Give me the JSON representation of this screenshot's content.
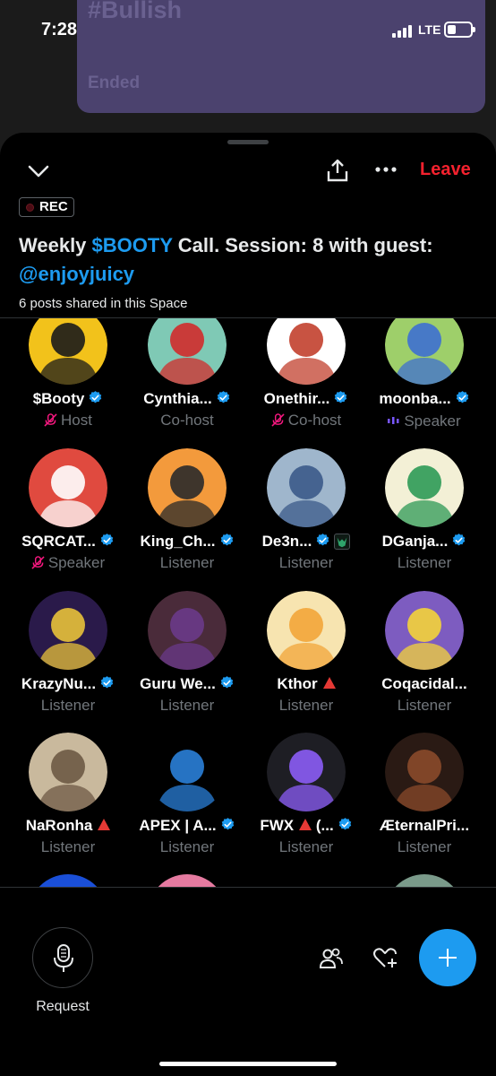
{
  "status": {
    "time": "7:28",
    "network": "LTE"
  },
  "background_card": {
    "title": "#Bullish",
    "status": "Ended"
  },
  "header": {
    "leave_label": "Leave",
    "rec_label": "REC"
  },
  "space": {
    "title_pre": "Weekly ",
    "title_ticker": "$BOOTY",
    "title_mid": " Call. Session: 8 with guest: ",
    "title_guest": "@enjoyjuicy",
    "posts_shared": "6 posts shared in this Space"
  },
  "participants": [
    {
      "name": "$Booty",
      "verified": true,
      "badge": "",
      "role": "Host",
      "mic": "muted",
      "avatar_colors": [
        "#f2c21b",
        "#1b1b1b"
      ]
    },
    {
      "name": "Cynthia...",
      "verified": true,
      "badge": "",
      "role": "Co-host",
      "mic": "none",
      "avatar_colors": [
        "#7fc9b5",
        "#d22b2b"
      ]
    },
    {
      "name": "Onethir...",
      "verified": true,
      "badge": "",
      "role": "Co-host",
      "mic": "muted",
      "avatar_colors": [
        "#ffffff",
        "#c2402e"
      ]
    },
    {
      "name": "moonba...",
      "verified": true,
      "badge": "",
      "role": "Speaker",
      "mic": "speaking",
      "avatar_colors": [
        "#9ecf6a",
        "#3d6fd1"
      ]
    },
    {
      "name": "SQRCAT...",
      "verified": true,
      "badge": "",
      "role": "Speaker",
      "mic": "muted",
      "avatar_colors": [
        "#e04a3f",
        "#ffffff"
      ]
    },
    {
      "name": "King_Ch...",
      "verified": true,
      "badge": "",
      "role": "Listener",
      "mic": "none",
      "avatar_colors": [
        "#f39a3c",
        "#2a2a2a"
      ]
    },
    {
      "name": "De3n...",
      "verified": true,
      "badge": "wolf",
      "role": "Listener",
      "mic": "none",
      "avatar_colors": [
        "#9fb6cc",
        "#3b5a8a"
      ]
    },
    {
      "name": "DGanja...",
      "verified": true,
      "badge": "",
      "role": "Listener",
      "mic": "none",
      "avatar_colors": [
        "#f3f0d6",
        "#2e9a56"
      ]
    },
    {
      "name": "KrazyNu...",
      "verified": true,
      "badge": "",
      "role": "Listener",
      "mic": "none",
      "avatar_colors": [
        "#2a1a4a",
        "#e8c23a"
      ]
    },
    {
      "name": "Guru We...",
      "verified": true,
      "badge": "",
      "role": "Listener",
      "mic": "none",
      "avatar_colors": [
        "#4a2b3a",
        "#6a3a8a"
      ]
    },
    {
      "name": "Kthor",
      "verified": false,
      "badge": "red",
      "role": "Listener",
      "mic": "none",
      "avatar_colors": [
        "#f7e4b0",
        "#f2a53a"
      ]
    },
    {
      "name": "Coqacidal...",
      "verified": false,
      "badge": "",
      "role": "Listener",
      "mic": "none",
      "avatar_colors": [
        "#7d5cc0",
        "#f4d33a"
      ]
    },
    {
      "name": "NaRonha",
      "verified": false,
      "badge": "red",
      "role": "Listener",
      "mic": "none",
      "avatar_colors": [
        "#c9b99d",
        "#6d5a45"
      ]
    },
    {
      "name": "APEX | A...",
      "verified": true,
      "badge": "",
      "role": "Listener",
      "mic": "none",
      "avatar_colors": [
        "#000000",
        "#2a7fd8"
      ]
    },
    {
      "name": "FWX",
      "verified": true,
      "badge": "red",
      "suffix": " (...",
      "role": "Listener",
      "mic": "none",
      "avatar_colors": [
        "#1e1e24",
        "#8b5cf6"
      ]
    },
    {
      "name": "ÆternalPri...",
      "verified": false,
      "badge": "",
      "role": "Listener",
      "mic": "none",
      "avatar_colors": [
        "#2a1a14",
        "#8a4a2a"
      ]
    }
  ],
  "next_row_peek_colors": [
    "#1a4fd8",
    "#e57aa0",
    "",
    "#7a9a8a"
  ],
  "footer": {
    "request_label": "Request"
  },
  "colors": {
    "accent": "#1d9bf0",
    "leave": "#f4212e",
    "muted_icon": "#f91880",
    "speaking": "#7856ff"
  }
}
